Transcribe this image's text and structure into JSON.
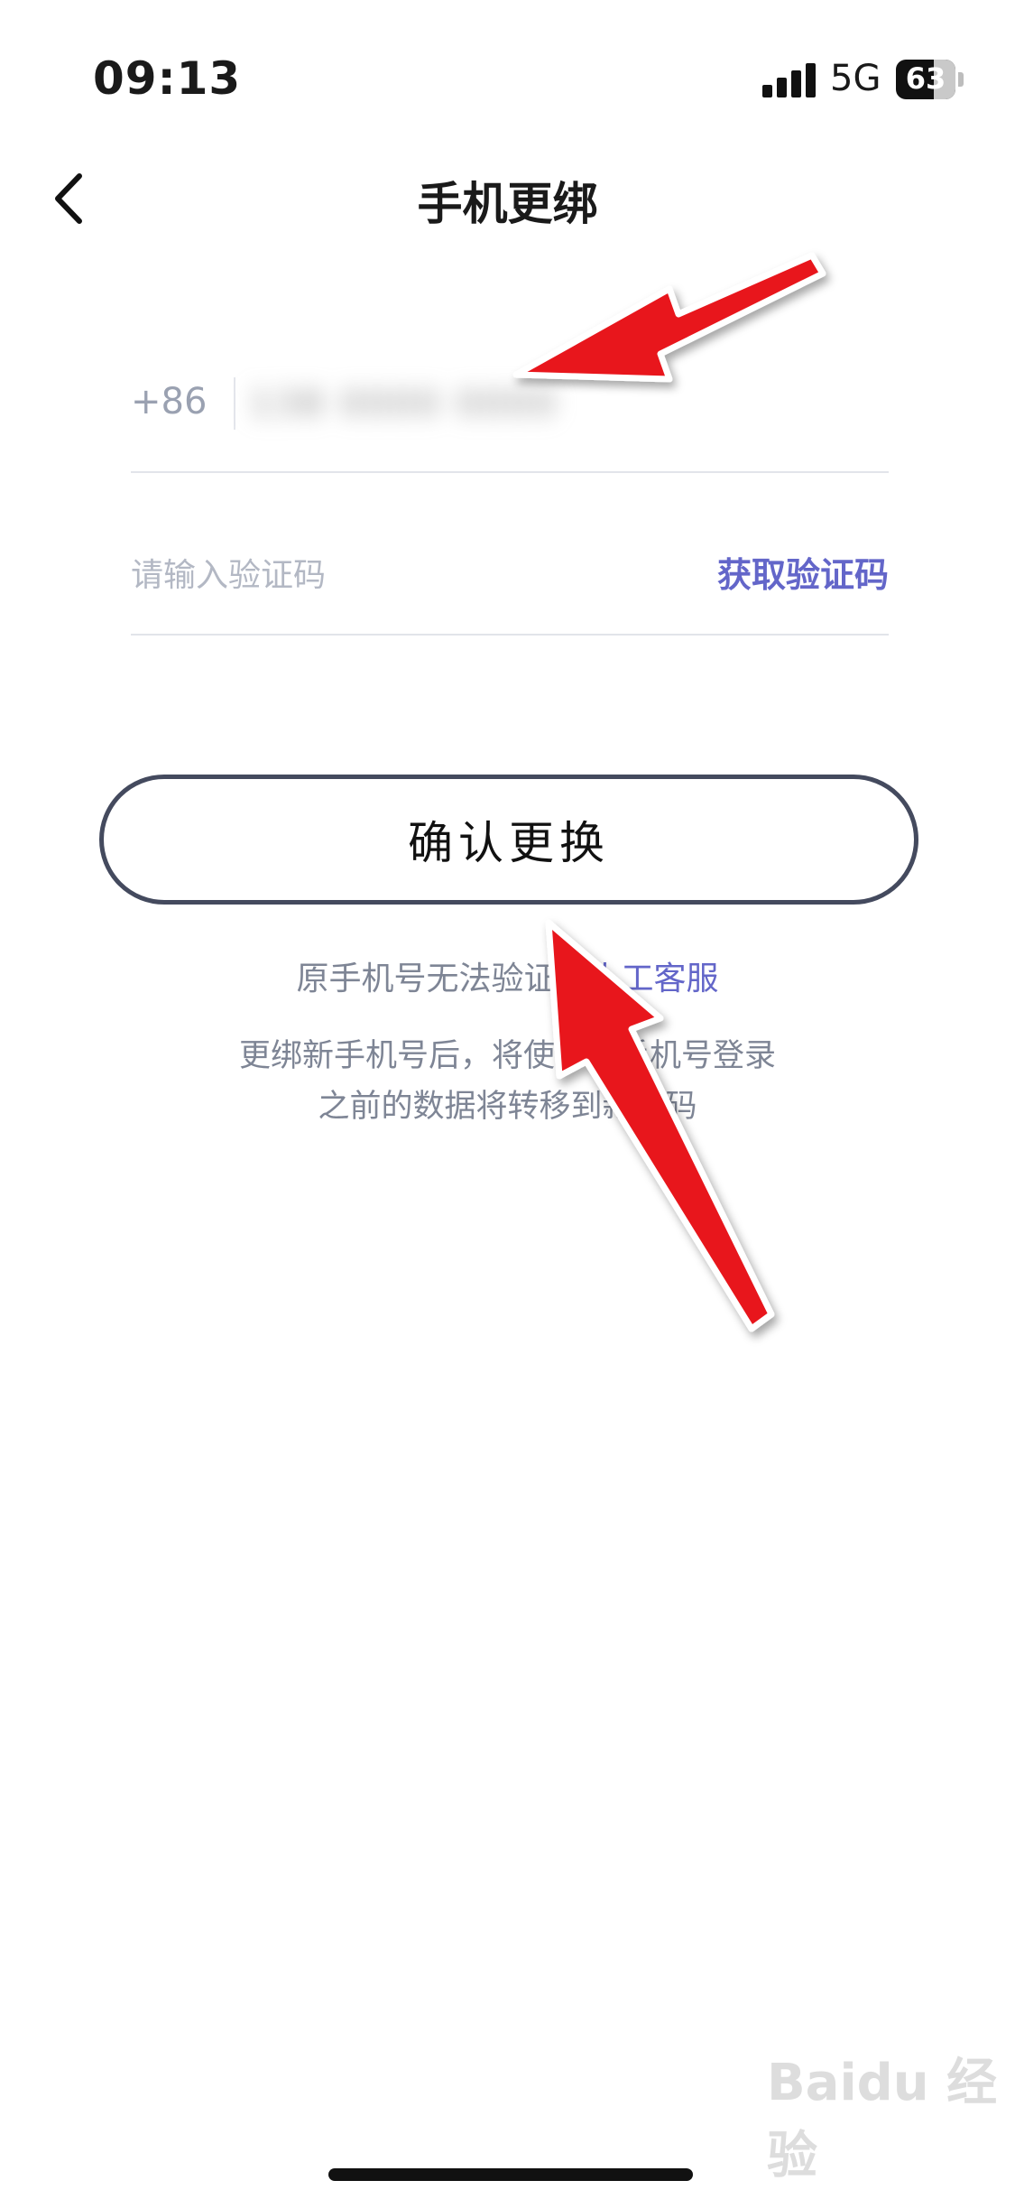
{
  "status_bar": {
    "time": "09:13",
    "network": "5G",
    "battery": "63"
  },
  "nav": {
    "back_icon": "chevron-left-icon",
    "title": "手机更绑"
  },
  "form": {
    "country_code": "+86",
    "phone_value": "138 0000 0000",
    "code_placeholder": "请输入验证码",
    "get_code_label": "获取验证码"
  },
  "confirm_button": "确认更换",
  "help": {
    "prefix": "原手机号无法验证？",
    "link": "人工客服"
  },
  "notice": {
    "line1": "更绑新手机号后，将使用新手机号登录",
    "line2": "之前的数据将转移到新号码"
  },
  "watermark": "Baidu 经验",
  "colors": {
    "accent": "#6366c9",
    "annotation_arrow": "#e8141c",
    "button_border": "#444a5e",
    "muted_text": "#7e8595"
  }
}
